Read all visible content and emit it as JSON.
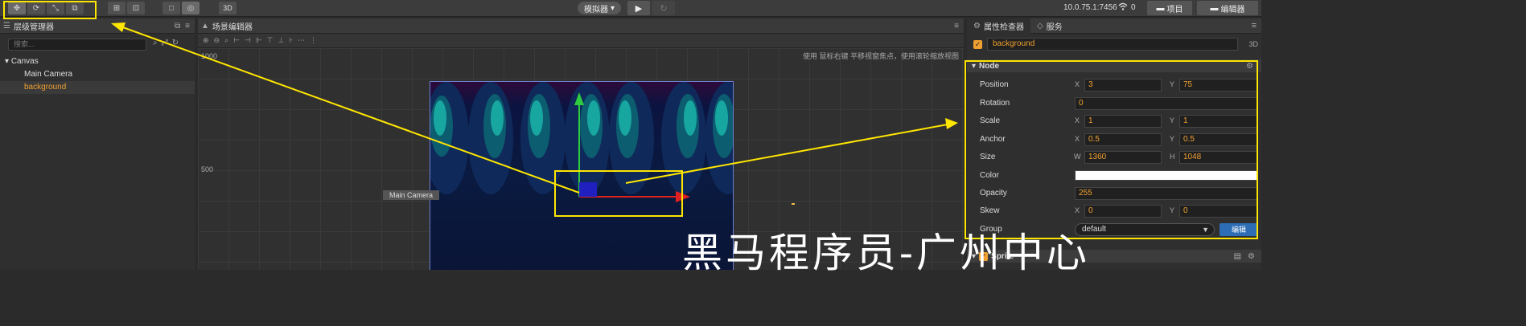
{
  "toolbar": {
    "transform_tools": [
      "✥",
      "⟳",
      "⤡",
      "⧉"
    ],
    "align_tools": [
      "⊞",
      "⊡"
    ],
    "gizmo_tools": [
      "□",
      "◎"
    ],
    "mode_3d": "3D",
    "simulator_label": "模拟器",
    "play_icon": "▶",
    "refresh_icon": "↻",
    "ip": "10.0.75.1:7456",
    "connection_count": "0",
    "project_label": "项目",
    "editor_label": "编辑器"
  },
  "hierarchy": {
    "title": "层级管理器",
    "search_placeholder": "搜索...",
    "tree": [
      {
        "label": "Canvas",
        "depth": 0,
        "expanded": true
      },
      {
        "label": "Main Camera",
        "depth": 1
      },
      {
        "label": "background",
        "depth": 1,
        "selected": true
      }
    ]
  },
  "scene": {
    "title": "场景编辑器",
    "hint": "使用 鼠标右键 平移视窗焦点，使用滚轮缩放视图",
    "ruler_labels": [
      "1000",
      "500"
    ],
    "camera_label": "Main Camera"
  },
  "inspector": {
    "tab_properties": "属性检查器",
    "tab_services": "服务",
    "node_name": "background",
    "mode_3d": "3D",
    "section_node": "Node",
    "properties": {
      "position": {
        "label": "Position",
        "x_axis": "X",
        "x": "3",
        "y_axis": "Y",
        "y": "75"
      },
      "rotation": {
        "label": "Rotation",
        "value": "0"
      },
      "scale": {
        "label": "Scale",
        "x_axis": "X",
        "x": "1",
        "y_axis": "Y",
        "y": "1"
      },
      "anchor": {
        "label": "Anchor",
        "x_axis": "X",
        "x": "0.5",
        "y_axis": "Y",
        "y": "0.5"
      },
      "size": {
        "label": "Size",
        "w_axis": "W",
        "w": "1360",
        "h_axis": "H",
        "h": "1048"
      },
      "color": {
        "label": "Color",
        "value": "#ffffff"
      },
      "opacity": {
        "label": "Opacity",
        "value": "255"
      },
      "skew": {
        "label": "Skew",
        "x_axis": "X",
        "x": "0",
        "y_axis": "Y",
        "y": "0"
      },
      "group": {
        "label": "Group",
        "value": "default",
        "edit_label": "编辑"
      }
    },
    "section_sprite": "Sprite"
  },
  "watermark": "黑马程序员-广州中心",
  "colors": {
    "accent_orange": "#f0a030",
    "highlight_yellow": "#ffe600",
    "edit_blue": "#2d6db5"
  }
}
